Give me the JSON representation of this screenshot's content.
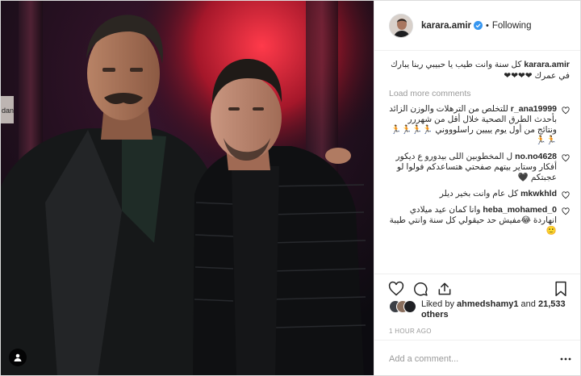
{
  "post": {
    "photo_alt": "two-men-photo",
    "photo_sign_text": "dan"
  },
  "header": {
    "username": "karara.amir",
    "separator": "•",
    "follow_label": "Following"
  },
  "caption": {
    "author": "karara.amir",
    "text": "كل سنة وانت طيب يا حبيبي ربنا يبارك في عمرك ❤❤❤❤"
  },
  "load_more_label": "Load more comments",
  "comments": [
    {
      "author": "r_ana19999",
      "text": "للتخلص من الترهلات والوزن الزائد بأحدث الطرق الصحية خلال أقل من شهررر ونتائج من أول يوم يييين راسلوووني 🏃🏃🏃🏃🏃🏃"
    },
    {
      "author": "no.no4628",
      "text": "ل المخطوبين اللى بيدورو ع ديكور أفكار وستاير بيتهم صفحتي هتساعدكم فولوا لو عجبتكم 🖤"
    },
    {
      "author": "mkwkhld",
      "text": "كل عام وانت بخير ديلر"
    },
    {
      "author": "heba_mohamed_0",
      "text": "وانا كمان عيد ميلادي انهاردة 😂مفيش حد حيقولي كل سنة وانتي طيبة🙂"
    }
  ],
  "likes": {
    "prefix": "Liked by",
    "user": "ahmedshamy1",
    "connector": "and",
    "count": "21,533 others"
  },
  "timestamp": "1 HOUR AGO",
  "add_comment": {
    "placeholder": "Add a comment..."
  },
  "colors": {
    "verified": "#3897f0",
    "muted": "#999999",
    "text": "#262626",
    "border": "#efefef"
  },
  "icons": [
    "user-tag-icon",
    "verified-badge-icon",
    "heart-icon",
    "comment-icon",
    "share-icon",
    "bookmark-icon",
    "more-options-icon"
  ]
}
